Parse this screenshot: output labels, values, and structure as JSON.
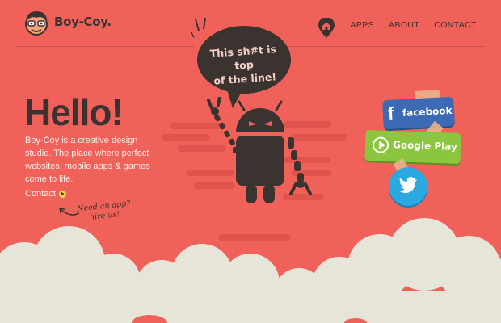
{
  "header": {
    "logo_text": "Boy-Coy.",
    "nav": {
      "home_icon": "home-icon",
      "links": [
        "APPS",
        "ABOUT",
        "CONTACT"
      ]
    }
  },
  "hero": {
    "title": "Hello!",
    "intro": "Boy-Coy is a creative design studio. The place where perfect websites, mobile apps & games come to life.",
    "contact_label": "Contact",
    "hire_note_line1": "Need an app?",
    "hire_note_line2": "hire us!"
  },
  "speech_bubble": {
    "line1": "This sh#t is top",
    "line2": "of the line!"
  },
  "social": {
    "facebook_label": "facebook",
    "google_play_label": "Google Play"
  },
  "colors": {
    "background": "#f0615a",
    "dark": "#3b3330",
    "cloud": "#e7e4da",
    "facebook": "#3d6ab4",
    "google_play": "#8cc63f",
    "twitter": "#2aa9e0"
  }
}
